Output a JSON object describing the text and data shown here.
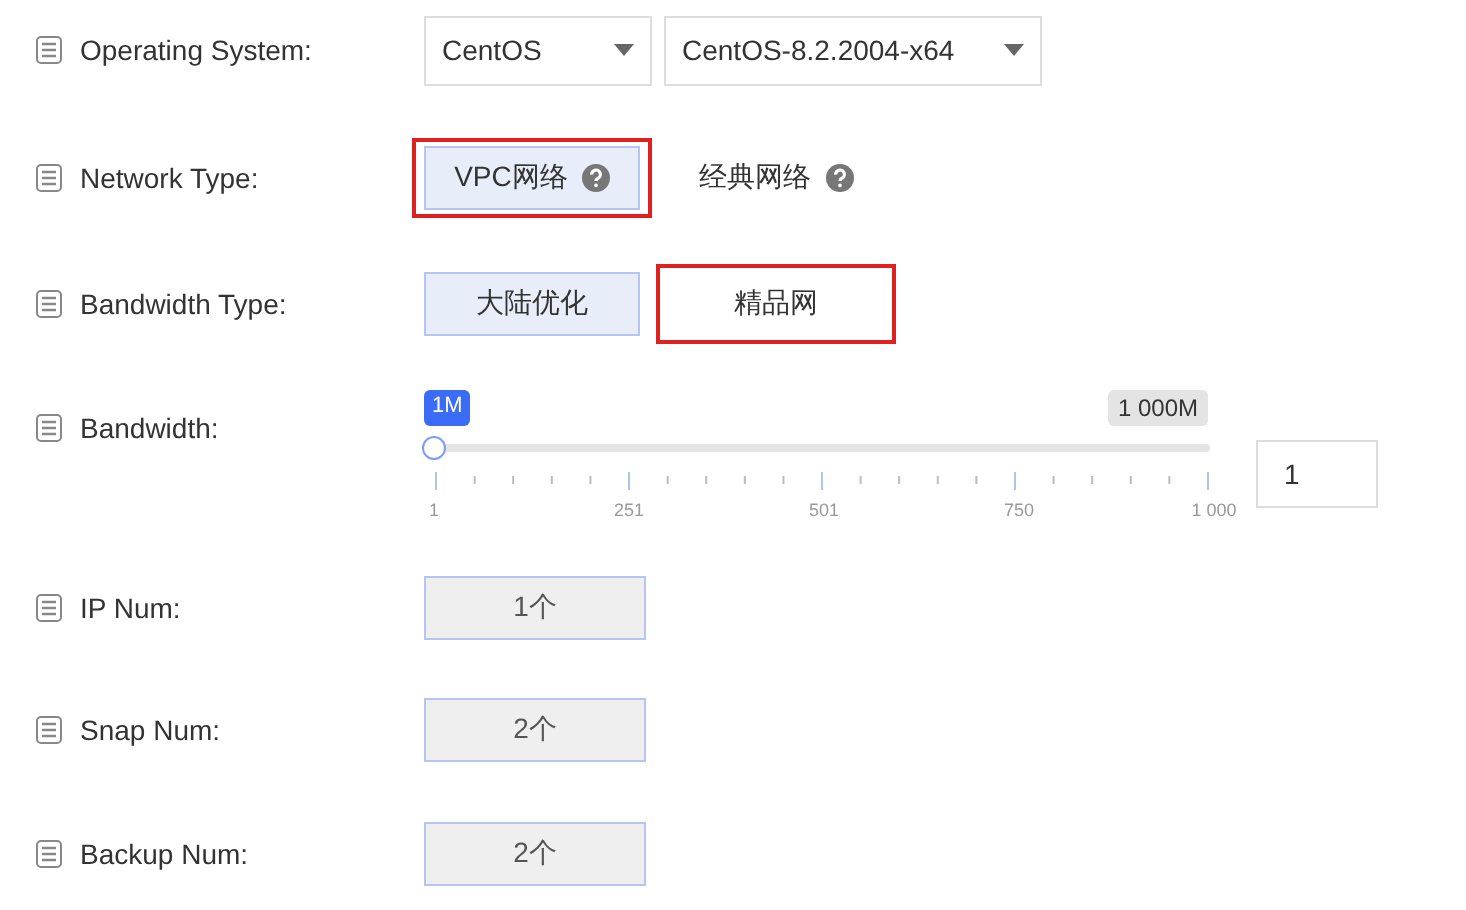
{
  "fields": [
    {
      "kind": "select",
      "label": "Operating System:",
      "selects": [
        {
          "value": "CentOS"
        },
        {
          "value": "CentOS-8.2.2004-x64"
        }
      ]
    },
    {
      "kind": "options",
      "label": "Network Type:",
      "options": [
        {
          "label": "VPC网络",
          "help": true,
          "selected": true,
          "highlighted": true
        },
        {
          "label": "经典网络",
          "help": true,
          "selected": false,
          "highlighted": false
        }
      ]
    },
    {
      "kind": "options",
      "label": "Bandwidth Type:",
      "options": [
        {
          "label": "大陆优化",
          "help": false,
          "selected": true,
          "highlighted": false
        },
        {
          "label": "精品网",
          "help": false,
          "selected": false,
          "highlighted": true
        }
      ]
    },
    {
      "kind": "slider",
      "label": "Bandwidth:",
      "min_badge": "1M",
      "max_badge": "1 000M",
      "level": 0,
      "tick_labels": [
        "1",
        "251",
        "501",
        "750",
        "1 000"
      ],
      "input_value": "1"
    },
    {
      "kind": "count",
      "label": "IP Num:",
      "value": "1个"
    },
    {
      "kind": "count",
      "label": "Snap Num:",
      "value": "2个"
    },
    {
      "kind": "count",
      "label": "Backup Num:",
      "value": "2个"
    }
  ]
}
